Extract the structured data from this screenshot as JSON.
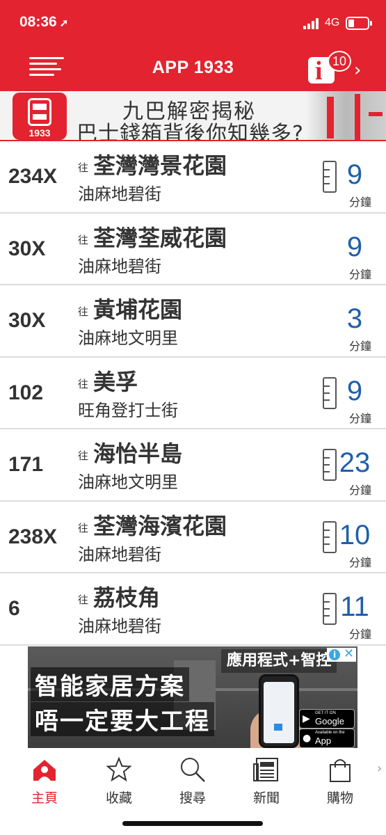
{
  "status": {
    "time": "08:36",
    "network": "4G"
  },
  "header": {
    "title": "APP 1933",
    "badge": "10"
  },
  "banner": {
    "line1": "九巴解密揭秘",
    "line2": "巴士錢箱背後你知幾多?",
    "logo_text": "1933"
  },
  "to_label": "往",
  "unit_label": "分鐘",
  "routes": [
    {
      "route": "234X",
      "dest": "荃灣灣景花園",
      "stop": "油麻地碧街",
      "eta": "9",
      "schedule_icon": true
    },
    {
      "route": "30X",
      "dest": "荃灣荃威花園",
      "stop": "油麻地碧街",
      "eta": "9",
      "schedule_icon": false
    },
    {
      "route": "30X",
      "dest": "黃埔花園",
      "stop": "油麻地文明里",
      "eta": "3",
      "schedule_icon": false
    },
    {
      "route": "102",
      "dest": "美孚",
      "stop": "旺角登打士街",
      "eta": "9",
      "schedule_icon": true
    },
    {
      "route": "171",
      "dest": "海怡半島",
      "stop": "油麻地文明里",
      "eta": "23",
      "schedule_icon": true
    },
    {
      "route": "238X",
      "dest": "荃灣海濱花園",
      "stop": "油麻地碧街",
      "eta": "10",
      "schedule_icon": true
    },
    {
      "route": "6",
      "dest": "荔枝角",
      "stop": "油麻地碧街",
      "eta": "11",
      "schedule_icon": true
    }
  ],
  "ad": {
    "tag": "應用程式+智控",
    "line1": "智能家居方案",
    "line2": "唔一定要大工程",
    "google_small": "GET IT ON",
    "google_large": "Google play",
    "apple_small": "Available on the",
    "apple_large": "App Store"
  },
  "nav": [
    {
      "label": "主頁",
      "icon": "home-icon",
      "active": true
    },
    {
      "label": "收藏",
      "icon": "star-icon",
      "active": false
    },
    {
      "label": "搜尋",
      "icon": "search-icon",
      "active": false
    },
    {
      "label": "新聞",
      "icon": "newspaper-icon",
      "active": false
    },
    {
      "label": "購物",
      "icon": "shopping-bag-icon",
      "active": false
    }
  ],
  "colors": {
    "brand_red": "#e3232f",
    "eta_blue": "#1f5fa8",
    "text_dark": "#333333"
  }
}
